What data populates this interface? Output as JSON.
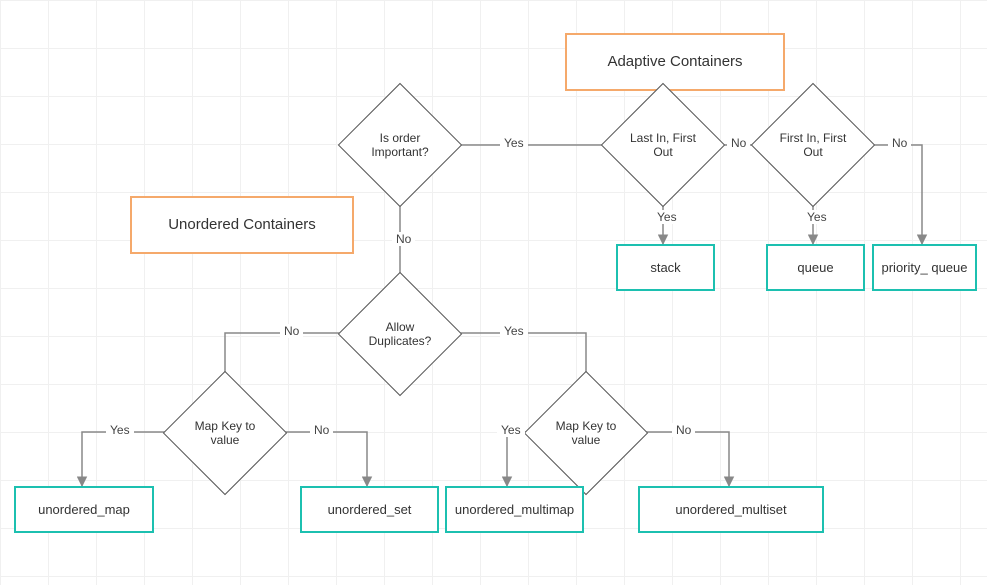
{
  "banners": {
    "adaptive": "Adaptive Containers",
    "unordered": "Unordered Containers"
  },
  "decisions": {
    "order": "Is order Important?",
    "lifo": "Last In, First Out",
    "fifo": "First In, First Out",
    "dups": "Allow Duplicates?",
    "map_left": "Map Key to value",
    "map_right": "Map Key to value"
  },
  "terminals": {
    "stack": "stack",
    "queue": "queue",
    "pqueue": "priority_ queue",
    "umap": "unordered_map",
    "uset": "unordered_set",
    "ummap": "unordered_multimap",
    "umset": "unordered_multiset"
  },
  "edges": {
    "yes": "Yes",
    "no": "No"
  }
}
